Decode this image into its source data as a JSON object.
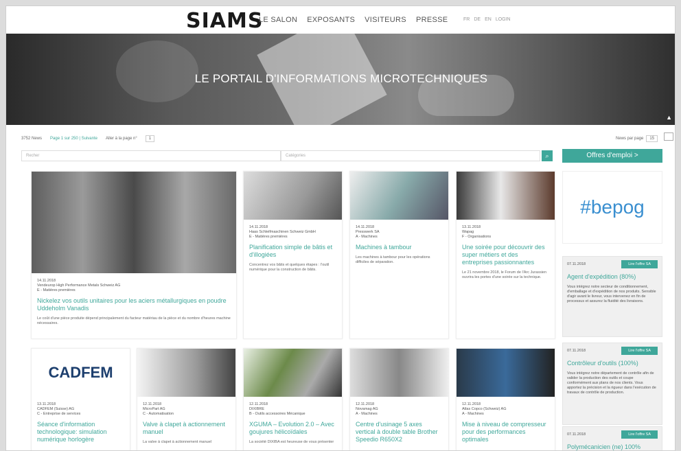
{
  "header": {
    "logo": "SIAMS",
    "nav": [
      "LE SALON",
      "EXPOSANTS",
      "VISITEURS",
      "PRESSE"
    ],
    "lang": [
      "FR",
      "DE",
      "EN",
      "LOGIN"
    ]
  },
  "hero": {
    "title": "LE PORTAIL D'INFORMATIONS MICROTECHNIQUES"
  },
  "pager": {
    "count": "3752 News",
    "page_label": "Page 1 sur 250 | Suivante",
    "goto": "Aller à la page n°",
    "goto_value": "1",
    "per_page_label": "News par page",
    "per_page_value": "15"
  },
  "filters": {
    "search_placeholder": "Recher",
    "categories_placeholder": "Catégories",
    "search_icon": "search-icon",
    "jobs_label": "Offres d'emploi  >"
  },
  "cards": [
    {
      "meta": [
        "14.11.2018",
        "Vendeurop High Performance Metals Schweiz AG",
        "E - Matières premières"
      ],
      "title": "Nickelez vos outils unitaires pour les aciers métallurgiques en poudre Uddeholm Vanadis",
      "desc": "Le coût d'une pièce produite dépend principalement du facteur matériau de la pièce et du nombre d'heures machine nécessaires."
    },
    {
      "meta": [
        "14.11.2018",
        "Haas Schleifmaschinen Schweiz GmbH",
        "E - Matières premières"
      ],
      "title": "Planification simple de bâtis et d'illogiées",
      "desc": "Concentrez vos bâtis et quelques étapes : l'outil numérique pour la construction de bâtis."
    },
    {
      "meta": [
        "14.11.2018",
        "Presswerk SA",
        "A - Machines"
      ],
      "title": "Machines à tambour",
      "desc": "Les machines à tambour pour les opérations difficiles de séparation."
    },
    {
      "meta": [
        "13.11.2018",
        "Wapag",
        "F - Organisations"
      ],
      "title": "Une soirée pour découvrir des super métiers et des entreprises passionnantes",
      "desc": "Le 21 novembre 2018, le Forum de l'Arc Jurassien ouvrira les portes d'une soirée sur la technique."
    },
    {
      "meta": [
        "13.11.2018",
        "CADFEM (Suisse) AG",
        "C - Entreprise de services"
      ],
      "title": "Séance d'information technologique: simulation numérique horlogère",
      "desc": ""
    },
    {
      "meta": [
        "12.11.2018",
        "MicroPart AG",
        "C - Automatisation"
      ],
      "title": "Valve à clapet à actionnement manuel",
      "desc": "La valve à clapet à actionnement manuel"
    },
    {
      "meta": [
        "12.11.2018",
        "DIXIBRE",
        "B - Outils accessoires Mécanique"
      ],
      "title": "XGUMA – Evolution 2.0 – Avec goujures hélicoïdales",
      "desc": "La société DIXIBA est heureuse de vous présenter"
    },
    {
      "meta": [
        "12.11.2018",
        "Novamag AG",
        "A - Machines"
      ],
      "title": "Centre d'usinage 5 axes vertical à double table Brother Speedio R650X2",
      "desc": ""
    },
    {
      "meta": [
        "12.11.2018",
        "Atlas Copco (Schweiz) AG",
        "A - Machines"
      ],
      "title": "Mise à niveau de compresseur pour des performances optimales",
      "desc": ""
    }
  ],
  "sidebar": {
    "logo_text": "#bepog",
    "jobs": [
      {
        "date": "07.11.2018",
        "button": "Lire l'offre SA",
        "title": "Agent d'expédition (80%)",
        "desc": "Vous intégrez notre secteur de conditionnement, d'emballage et d'expédition de nos produits. Sensible d'agir avant le livreur, vous intervenez en fin de processus et assurez la fluidité des livraisons."
      },
      {
        "date": "07.11.2018",
        "button": "Lire l'offre SA",
        "title": "Contrôleur d'outils (100%)",
        "desc": "Vous intégrez notre département de contrôle afin de valider la production des outils et coupe conformément aux plans de nos clients. Vous apportez la précision et la rigueur dans l'exécution de travaux de contrôle de production."
      },
      {
        "date": "07.11.2018",
        "button": "Lire l'offre SA",
        "title": "Polymécanicien (ne) 100%",
        "desc": ""
      }
    ]
  }
}
